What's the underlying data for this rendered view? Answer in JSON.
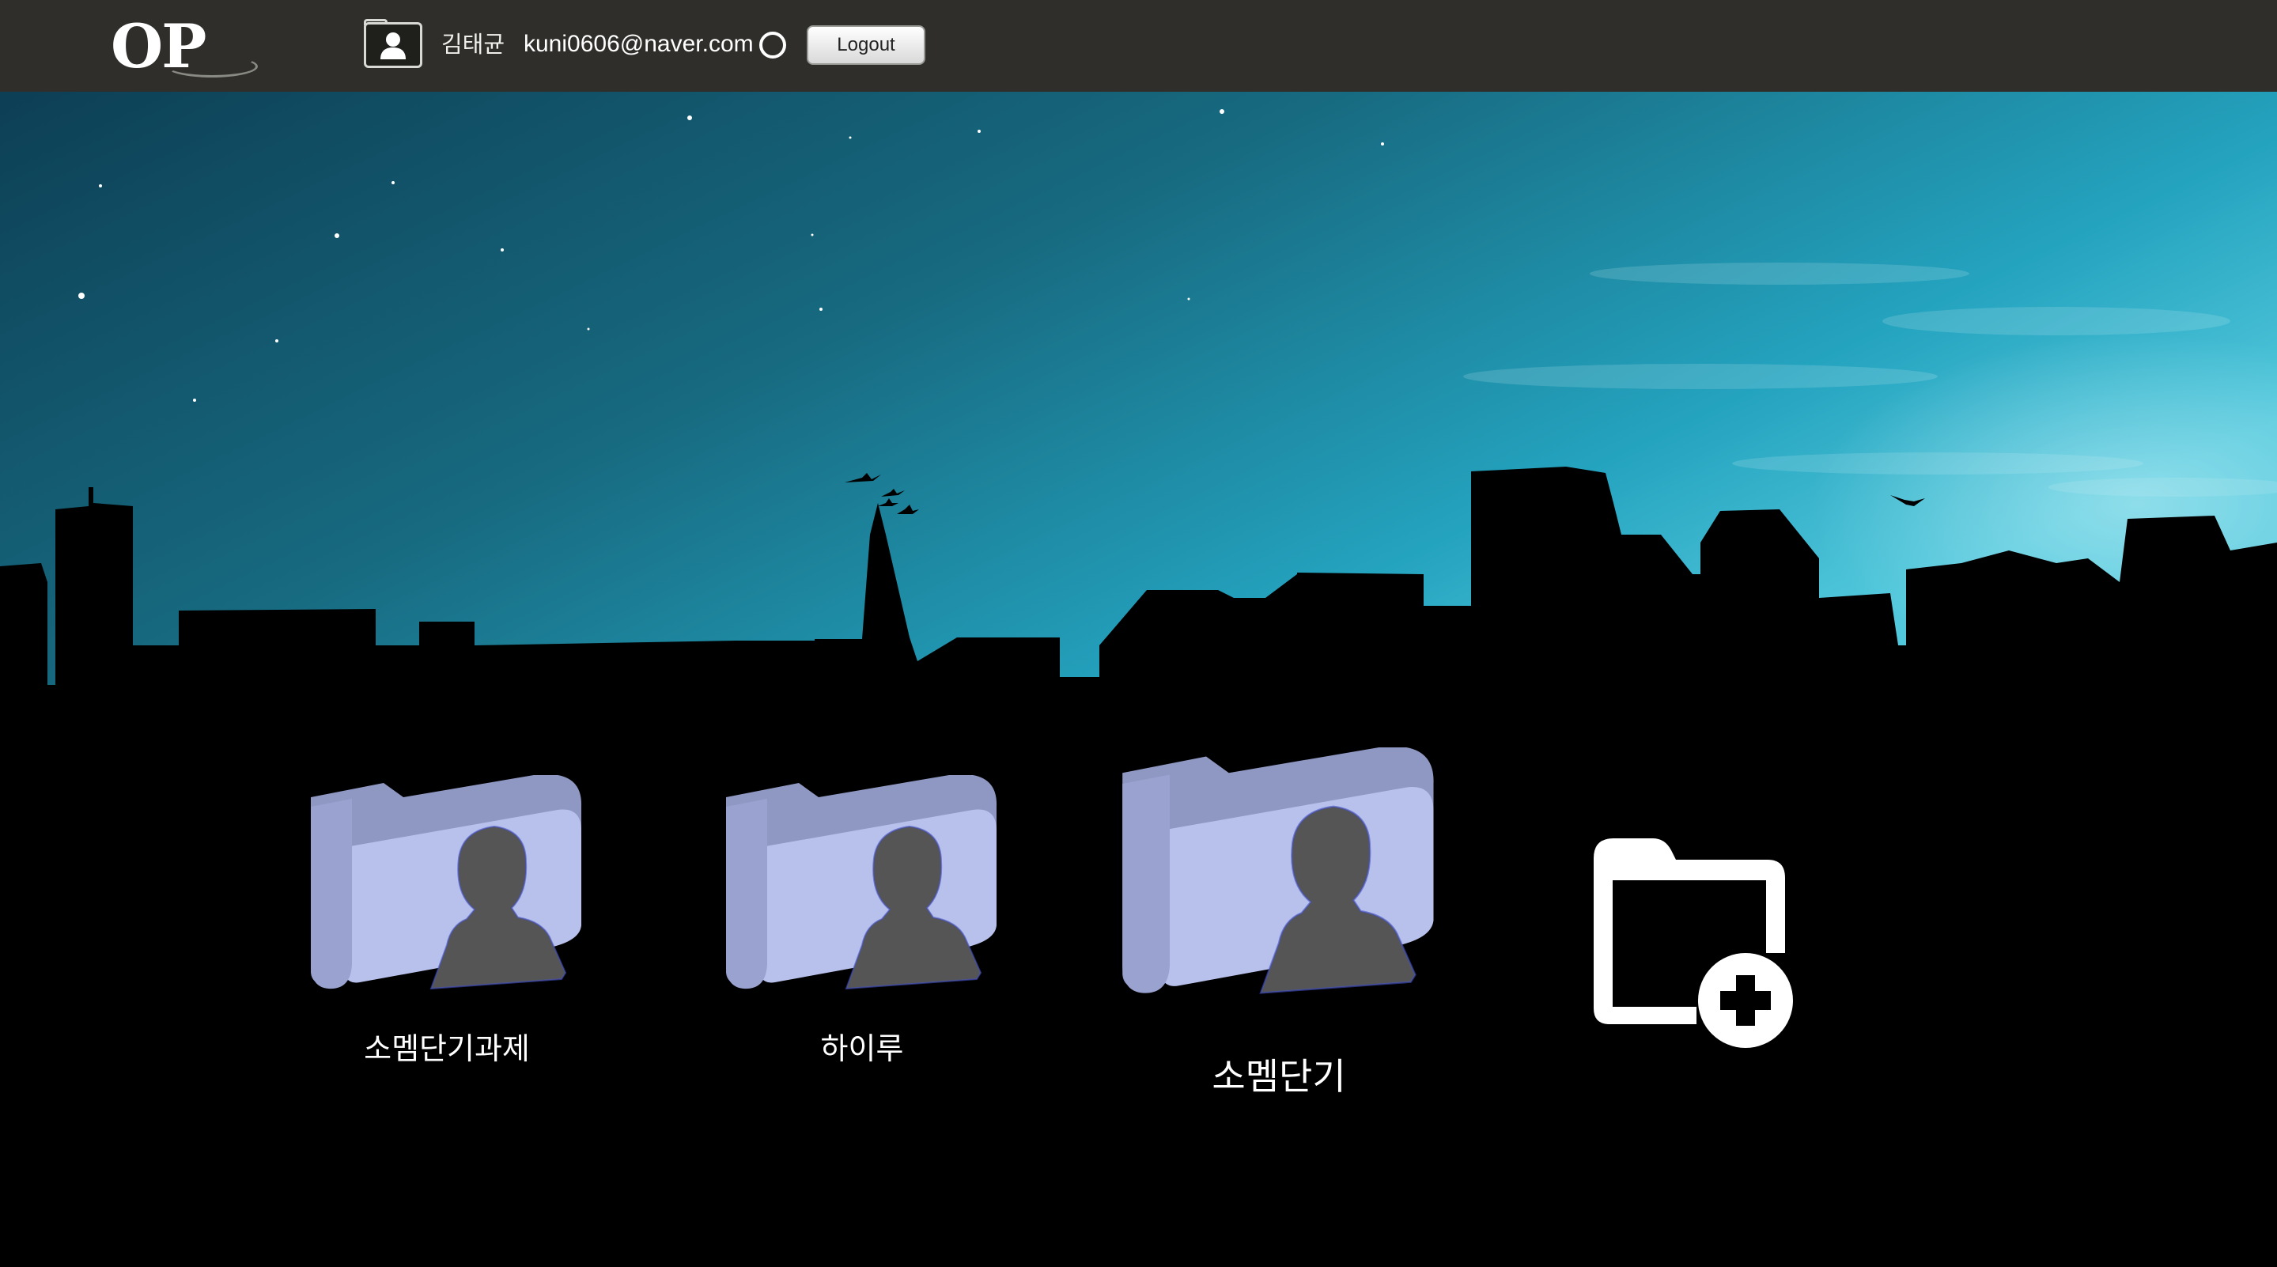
{
  "header": {
    "logo_text": "OP",
    "user_name": "김태균",
    "user_email": "kuni0606@naver.com",
    "logout_label": "Logout"
  },
  "folders": [
    {
      "label": "소멤단기과제"
    },
    {
      "label": "하이루"
    },
    {
      "label": "소멤단기"
    }
  ],
  "icons": {
    "user": "user-folder-icon",
    "status": "status-circle-icon",
    "add_folder": "add-folder-icon"
  },
  "colors": {
    "topbar": "#2f2e2a",
    "sky_top": "#0f4b62",
    "sky_bottom": "#2ab6cf",
    "folder": "#b4bde8"
  }
}
